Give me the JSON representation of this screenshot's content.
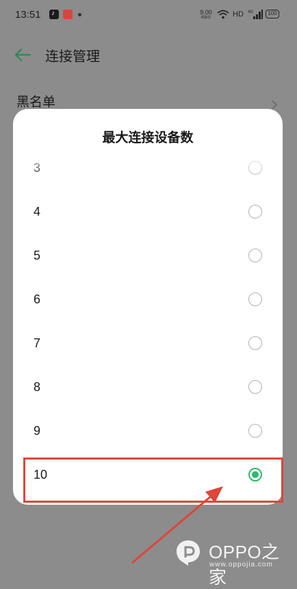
{
  "status_bar": {
    "time": "13:51",
    "net_speed": "9.00",
    "net_unit": "KB/S",
    "hd": "HD",
    "battery": "100"
  },
  "header": {
    "title": "连接管理"
  },
  "background_row": {
    "label": "黑名单"
  },
  "dialog": {
    "title": "最大连接设备数",
    "options": [
      {
        "label": "3",
        "selected": false
      },
      {
        "label": "4",
        "selected": false
      },
      {
        "label": "5",
        "selected": false
      },
      {
        "label": "6",
        "selected": false
      },
      {
        "label": "7",
        "selected": false
      },
      {
        "label": "8",
        "selected": false
      },
      {
        "label": "9",
        "selected": false
      },
      {
        "label": "10",
        "selected": true
      }
    ]
  },
  "colors": {
    "accent": "#2fb86c",
    "annotation": "#e0443a",
    "overlay": "#8c8c8c"
  },
  "watermark": {
    "brand": "OPPO之家",
    "url": "www.oppojia.com"
  }
}
